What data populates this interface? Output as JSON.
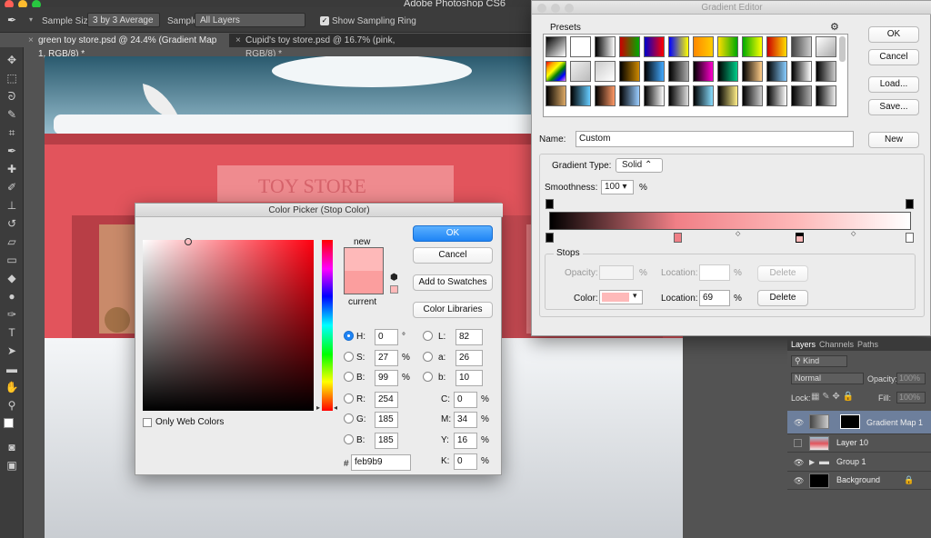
{
  "app": {
    "title": "Adobe Photoshop CS6"
  },
  "options_bar": {
    "sample_size_label": "Sample Size:",
    "sample_size_value": "3 by 3 Average",
    "sample_label": "Sample:",
    "sample_value": "All Layers",
    "show_ring_label": "Show Sampling Ring"
  },
  "doc_tabs": [
    {
      "label": "green toy store.psd @ 24.4% (Gradient Map 1, RGB/8) *"
    },
    {
      "label": "Cupid's toy store.psd @ 16.7% (pink, RGB/8) *"
    }
  ],
  "canvas": {
    "sign_text": "TOY STORE"
  },
  "color_picker": {
    "title": "Color Picker (Stop Color)",
    "new_label": "new",
    "current_label": "current",
    "ok": "OK",
    "cancel": "Cancel",
    "add_swatches": "Add to Swatches",
    "color_libraries": "Color Libraries",
    "only_web": "Only Web Colors",
    "hex_prefix": "#",
    "hex": "feb9b9",
    "fields": {
      "H": {
        "label": "H:",
        "value": "0",
        "unit": "°"
      },
      "S": {
        "label": "S:",
        "value": "27",
        "unit": "%"
      },
      "Bv": {
        "label": "B:",
        "value": "99",
        "unit": "%"
      },
      "R": {
        "label": "R:",
        "value": "254"
      },
      "G": {
        "label": "G:",
        "value": "185"
      },
      "Bb": {
        "label": "B:",
        "value": "185"
      },
      "L": {
        "label": "L:",
        "value": "82"
      },
      "a": {
        "label": "a:",
        "value": "26"
      },
      "b": {
        "label": "b:",
        "value": "10"
      },
      "C": {
        "label": "C:",
        "value": "0",
        "unit": "%"
      },
      "M": {
        "label": "M:",
        "value": "34",
        "unit": "%"
      },
      "Y": {
        "label": "Y:",
        "value": "16",
        "unit": "%"
      },
      "K": {
        "label": "K:",
        "value": "0",
        "unit": "%"
      }
    },
    "colors": {
      "new": "#feb9b9",
      "current": "#fb9e9e"
    }
  },
  "gradient_editor": {
    "title": "Gradient Editor",
    "presets_label": "Presets",
    "ok": "OK",
    "cancel": "Cancel",
    "load": "Load...",
    "save": "Save...",
    "name_label": "Name:",
    "name_value": "Custom",
    "new_button": "New",
    "gradient_type_label": "Gradient Type:",
    "gradient_type_value": "Solid",
    "smoothness_label": "Smoothness:",
    "smoothness_value": "100",
    "smoothness_unit": "%",
    "stops_label": "Stops",
    "opacity_label": "Opacity:",
    "location_label": "Location:",
    "delete_label": "Delete",
    "color_label": "Color:",
    "location_value": "69",
    "pct": "%"
  },
  "layers_panel": {
    "tabs": [
      "Layers",
      "Channels",
      "Paths"
    ],
    "kind": "Kind",
    "blend": "Normal",
    "opacity_label": "Opacity:",
    "opacity_value": "100%",
    "lock_label": "Lock:",
    "fill_label": "Fill:",
    "fill_value": "100%",
    "layers": [
      {
        "name": "Gradient Map 1"
      },
      {
        "name": "Layer 10"
      },
      {
        "name": "Group 1"
      },
      {
        "name": "Background"
      }
    ]
  }
}
